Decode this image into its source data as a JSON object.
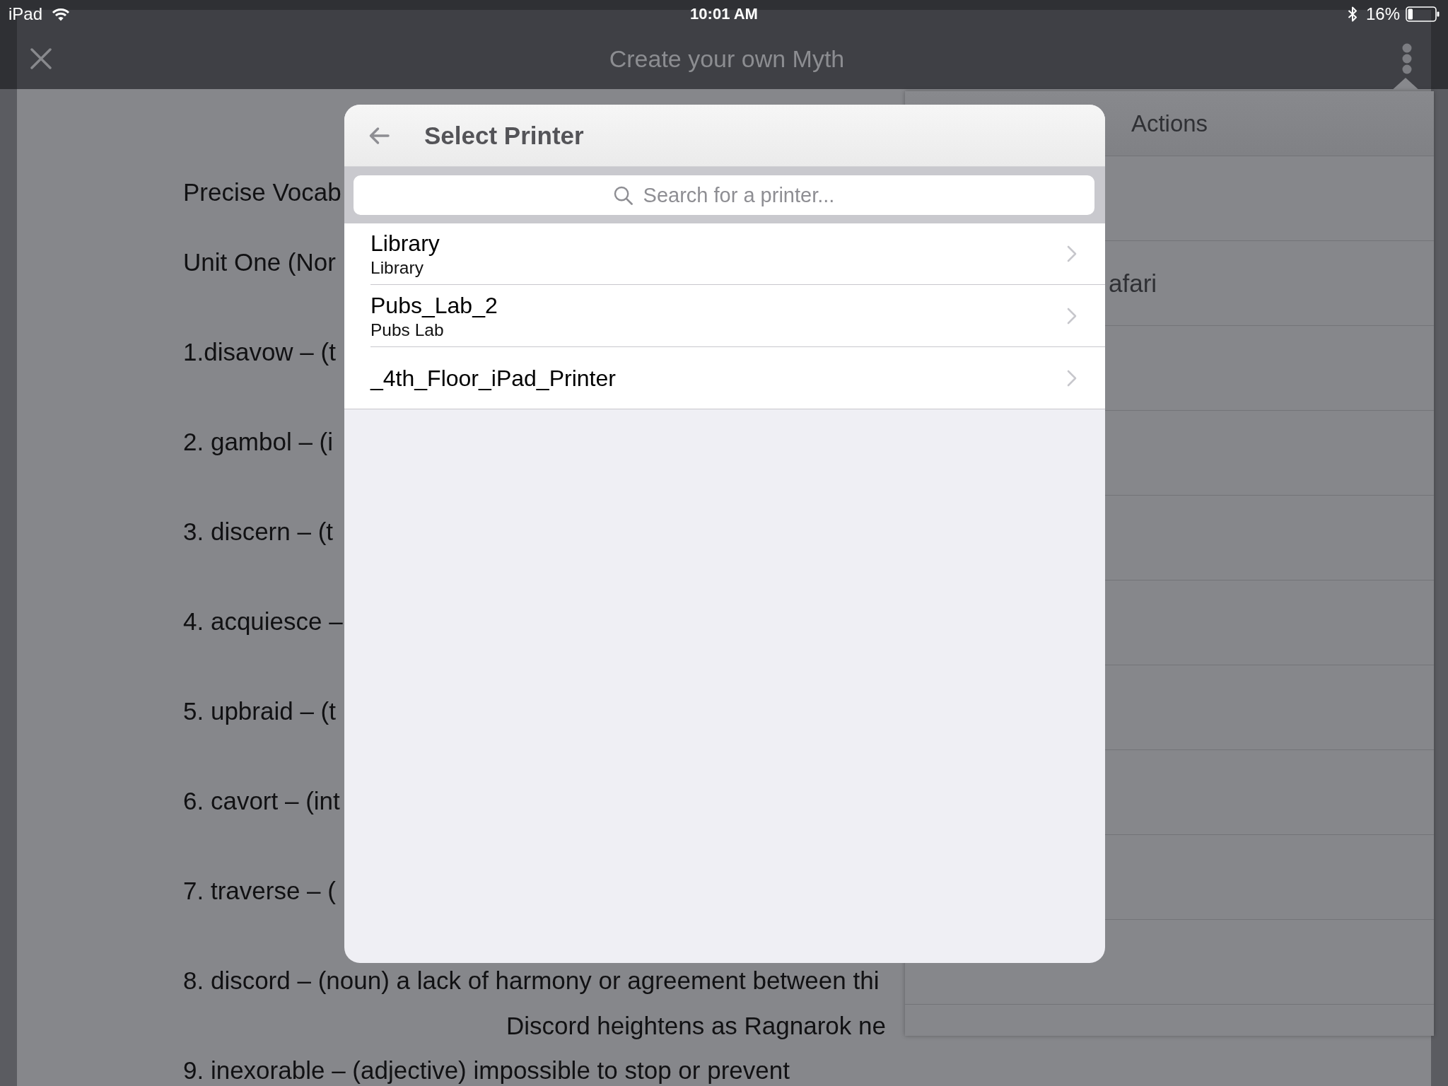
{
  "status_bar": {
    "device": "iPad",
    "time": "10:01 AM",
    "battery": "16%"
  },
  "nav_bar": {
    "title": "Create your own Myth"
  },
  "document": {
    "headings": [
      "Precise Vocab",
      "Unit One (Nor"
    ],
    "entries": [
      {
        "text": "1.disavow – (t"
      },
      {
        "text": "2. gambol – (i"
      },
      {
        "text": "3. discern – (t"
      },
      {
        "text": "4. acquiesce –"
      },
      {
        "text": "5. upbraid – (t"
      },
      {
        "text": "6. cavort – (int"
      },
      {
        "text": "7. traverse – ("
      },
      {
        "text": "8. discord – (noun) a lack of harmony or agreement between thi",
        "example": "Discord heightens as Ragnarok ne"
      },
      {
        "text": "9. inexorable – (adjective) impossible to stop or prevent"
      }
    ]
  },
  "actions_popover": {
    "title": "Actions",
    "items": [
      {
        "label": "afari"
      }
    ]
  },
  "print_dialog": {
    "title": "Select Printer",
    "search": {
      "placeholder": "Search for a printer..."
    },
    "printers": [
      {
        "name": "Library",
        "location": "Library"
      },
      {
        "name": "Pubs_Lab_2",
        "location": "Pubs Lab"
      },
      {
        "name": "_4th_Floor_iPad_Printer"
      }
    ]
  }
}
